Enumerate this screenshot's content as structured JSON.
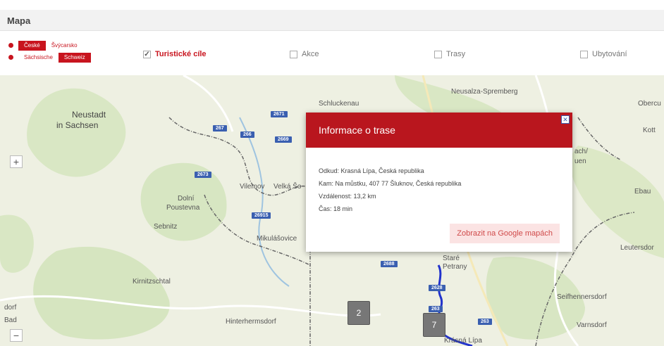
{
  "window": {
    "title": "Mapa"
  },
  "logo": {
    "row1": [
      "České",
      "Švýcarsko"
    ],
    "row2": [
      "Sächsische",
      "Schweiz"
    ],
    "color": "#c8141e"
  },
  "filters": [
    {
      "label": "Turistické cíle",
      "checked": true,
      "checkmark": "✓"
    },
    {
      "label": "Akce",
      "checked": false,
      "checkmark": ""
    },
    {
      "label": "Trasy",
      "checked": false,
      "checkmark": ""
    },
    {
      "label": "Ubytování",
      "checked": false,
      "checkmark": ""
    }
  ],
  "map": {
    "zoom_in": "+",
    "zoom_out": "−",
    "places": {
      "neustadt": "Neustadt",
      "neustadt2": "in Sachsen",
      "schluckenau": "Schluckenau",
      "neusalza": "Neusalza-Spremberg",
      "ober": "Obercu",
      "kott": "Kott",
      "hach": "ach/",
      "uen": "uen",
      "ebau": "Ebau",
      "leutersdorf": "Leutersdor",
      "vilemov": "Vilemov",
      "velka": "Velká Šo",
      "dolni": "Dolní",
      "poustevna": "Poustevna",
      "sebnitz": "Sebnitz",
      "mikulasovice": "Mikulášovice",
      "kirnitzschtal": "Kirnitzschtal",
      "hinter": "Hinterhermsdorf",
      "stare": "Staré",
      "petrany": "Petrany",
      "seifhenn": "Seifhennersdorf",
      "varnsdorf": "Varnsdorf",
      "krasna": "Krásná Lípa",
      "dorf": "dorf",
      "bad": "Bad"
    },
    "road_badges": [
      "267",
      "2671",
      "266",
      "2669",
      "2673",
      "26915",
      "2688",
      "2628",
      "263",
      "263"
    ],
    "markers": [
      "2",
      "7"
    ],
    "route_color": "#2233cc"
  },
  "popup": {
    "title": "Informace o trase",
    "close_glyph": "✕",
    "lines": {
      "from": "Odkud: Krasná Lípa, Česká republika",
      "to": "Kam: Na můstku, 407 77 Šluknov, Česká republika",
      "distance": "Vzdálenost: 13,2 km",
      "time": "Čas: 18 min"
    },
    "google_button": "Zobrazit na Google mapách"
  }
}
